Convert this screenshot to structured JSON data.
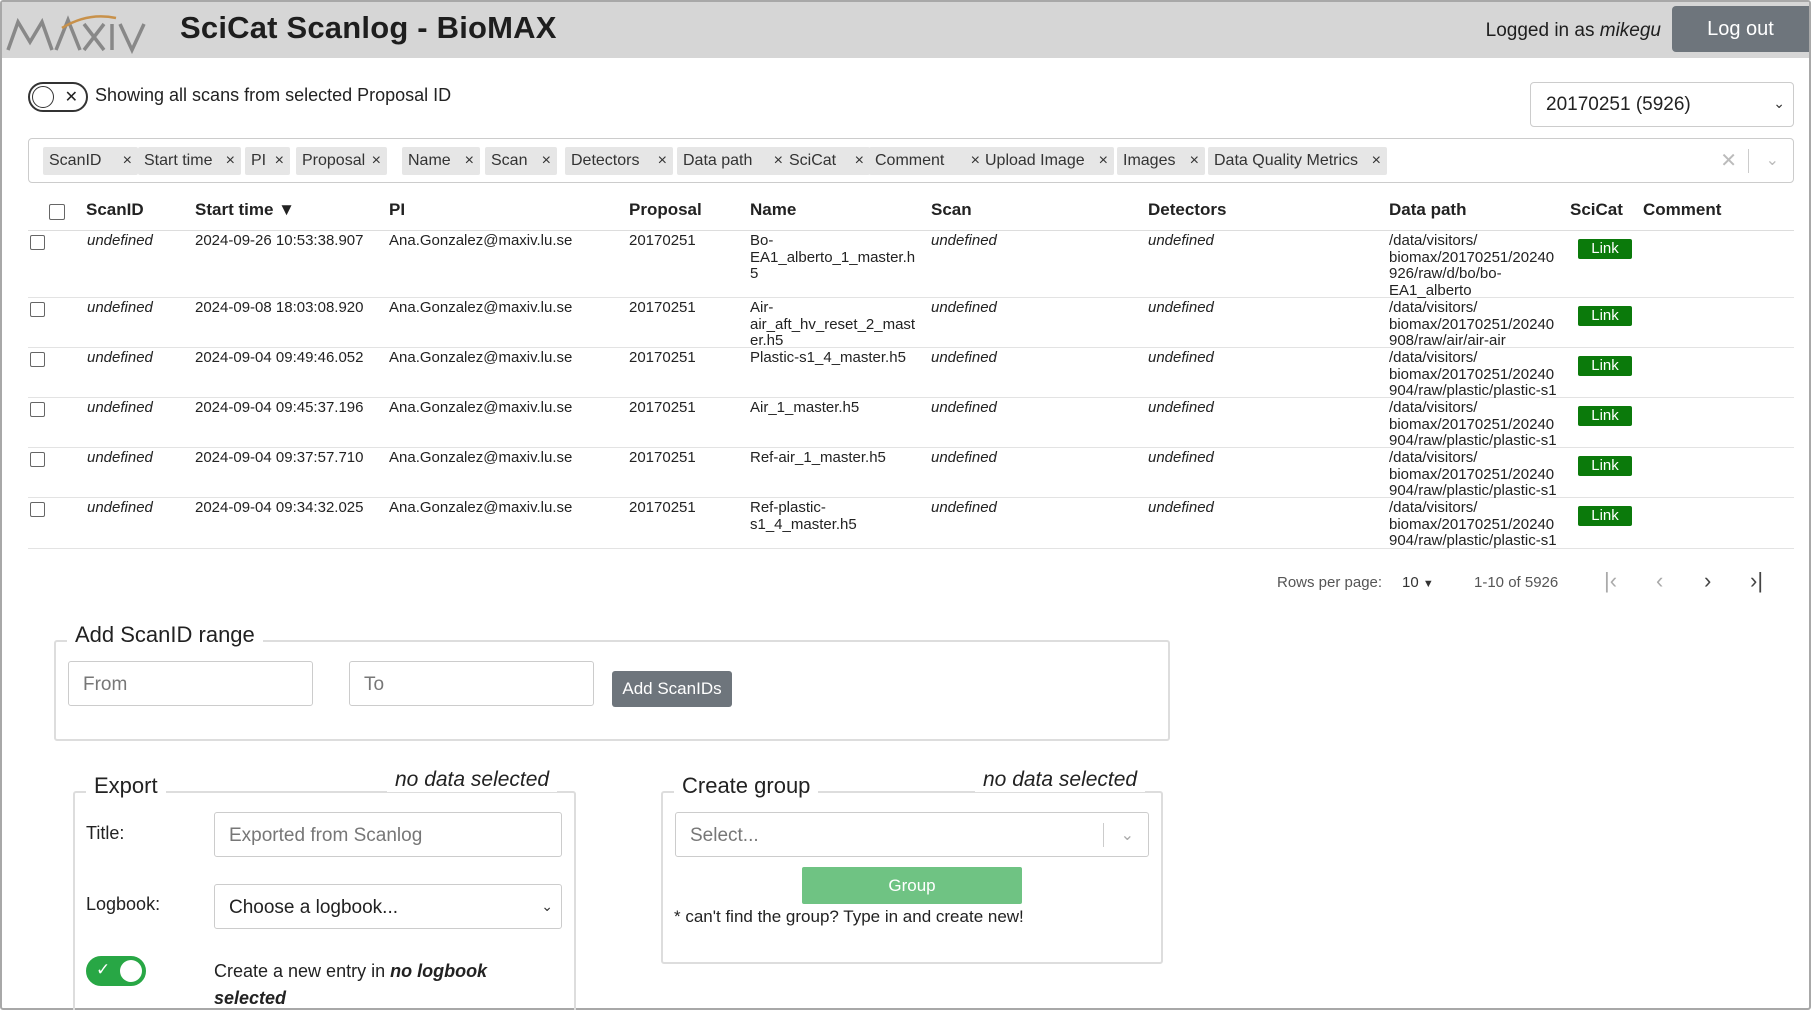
{
  "header": {
    "logo_text": "MAX IV",
    "title": "SciCat Scanlog - BioMAX",
    "logged_in_prefix": "Logged in as ",
    "username": "mikegu",
    "logout_label": "Log out"
  },
  "scope_toggle": {
    "label": "Showing all scans from selected Proposal ID",
    "on": false
  },
  "proposal_select": {
    "value": "20170251 (5926)"
  },
  "column_chips": [
    "ScanID",
    "Start time",
    "PI",
    "Proposal",
    "Name",
    "Scan",
    "Detectors",
    "Data path",
    "SciCat",
    "Comment",
    "Upload Image",
    "Images",
    "Data Quality Metrics"
  ],
  "table": {
    "headers": {
      "scanid": "ScanID",
      "start_time": "Start time ▼",
      "pi": "PI",
      "proposal": "Proposal",
      "name": "Name",
      "scan": "Scan",
      "detectors": "Detectors",
      "data_path": "Data path",
      "scicat": "SciCat",
      "comment": "Comment"
    },
    "rows": [
      {
        "scanid": "undefined",
        "start_time": "2024-09-26 10:53:38.907",
        "pi": "Ana.Gonzalez@maxiv.lu.se",
        "proposal": "20170251",
        "name": "Bo-\nEA1_alberto_1_master.h\n5",
        "scan": "undefined",
        "detectors": "undefined",
        "data_path": "/data/visitors/\nbiomax/20170251/20240\n926/raw/d/bo/bo-\nEA1_alberto",
        "scicat": "Link",
        "comment": ""
      },
      {
        "scanid": "undefined",
        "start_time": "2024-09-08 18:03:08.920",
        "pi": "Ana.Gonzalez@maxiv.lu.se",
        "proposal": "20170251",
        "name": "Air-\nair_aft_hv_reset_2_mast\ner.h5",
        "scan": "undefined",
        "detectors": "undefined",
        "data_path": "/data/visitors/\nbiomax/20170251/20240\n908/raw/air/air-air",
        "scicat": "Link",
        "comment": ""
      },
      {
        "scanid": "undefined",
        "start_time": "2024-09-04 09:49:46.052",
        "pi": "Ana.Gonzalez@maxiv.lu.se",
        "proposal": "20170251",
        "name": "Plastic-s1_4_master.h5",
        "scan": "undefined",
        "detectors": "undefined",
        "data_path": "/data/visitors/\nbiomax/20170251/20240\n904/raw/plastic/plastic-s1",
        "scicat": "Link",
        "comment": ""
      },
      {
        "scanid": "undefined",
        "start_time": "2024-09-04 09:45:37.196",
        "pi": "Ana.Gonzalez@maxiv.lu.se",
        "proposal": "20170251",
        "name": "Air_1_master.h5",
        "scan": "undefined",
        "detectors": "undefined",
        "data_path": "/data/visitors/\nbiomax/20170251/20240\n904/raw/plastic/plastic-s1",
        "scicat": "Link",
        "comment": ""
      },
      {
        "scanid": "undefined",
        "start_time": "2024-09-04 09:37:57.710",
        "pi": "Ana.Gonzalez@maxiv.lu.se",
        "proposal": "20170251",
        "name": "Ref-air_1_master.h5",
        "scan": "undefined",
        "detectors": "undefined",
        "data_path": "/data/visitors/\nbiomax/20170251/20240\n904/raw/plastic/plastic-s1",
        "scicat": "Link",
        "comment": ""
      },
      {
        "scanid": "undefined",
        "start_time": "2024-09-04 09:34:32.025",
        "pi": "Ana.Gonzalez@maxiv.lu.se",
        "proposal": "20170251",
        "name": "Ref-plastic-\ns1_4_master.h5",
        "scan": "undefined",
        "detectors": "undefined",
        "data_path": "/data/visitors/\nbiomax/20170251/20240\n904/raw/plastic/plastic-s1",
        "scicat": "Link",
        "comment": ""
      }
    ]
  },
  "pagination": {
    "rows_per_page_label": "Rows per page:",
    "rows_per_page": "10",
    "range": "1-10 of 5926"
  },
  "scan_range": {
    "legend": "Add ScanID range",
    "from_placeholder": "From",
    "to_placeholder": "To",
    "add_label": "Add ScanIDs"
  },
  "export": {
    "legend": "Export",
    "status": "no data selected",
    "title_label": "Title:",
    "title_placeholder": "Exported from Scanlog",
    "logbook_label": "Logbook:",
    "logbook_value": "Choose a logbook...",
    "new_entry_prefix": "Create a new entry in ",
    "new_entry_target": "no logbook",
    "new_entry_target2": "selected",
    "new_entry_on": true
  },
  "group": {
    "legend": "Create group",
    "status": "no data selected",
    "select_placeholder": "Select...",
    "group_label": "Group",
    "hint": "* can't find the group? Type in and create new!"
  },
  "colors": {
    "header_bg": "#d6d6d6",
    "button_gray": "#6e757c",
    "link_green": "#0b7a0b",
    "toggle_green": "#28a745",
    "group_button": "#6fc383"
  }
}
